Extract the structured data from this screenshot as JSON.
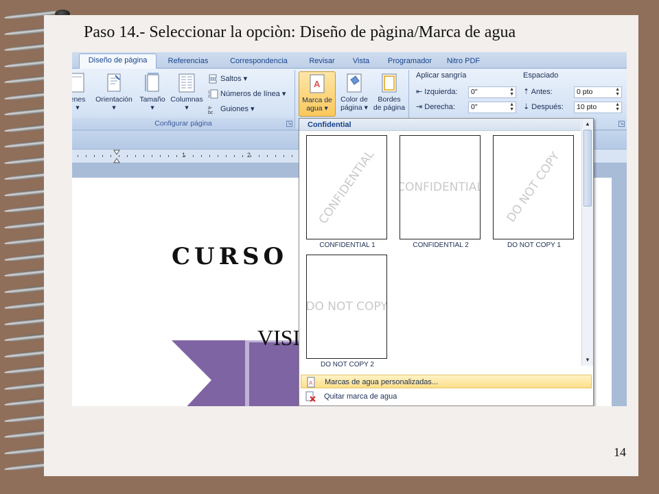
{
  "slide": {
    "title": "Paso 14.- Seleccionar la opciòn: Diseño de pàgina/Marca de agua",
    "page_number": "14"
  },
  "ribbon_tabs": [
    "Diseño de página",
    "Referencias",
    "Correspondencia",
    "Revisar",
    "Vista",
    "Programador",
    "Nitro PDF"
  ],
  "active_tab": "Diseño de página",
  "configurar_pagina": {
    "group_label": "Configurar página",
    "margenes": "enes",
    "orientacion": "Orientación",
    "tamano": "Tamaño",
    "columnas": "Columnas",
    "saltos": "Saltos",
    "numeros_linea": "Números de línea",
    "guiones": "Guiones"
  },
  "fondo_pagina": {
    "marca_de_agua": [
      "Marca de",
      "agua"
    ],
    "color_de_pagina": [
      "Color de",
      "página"
    ],
    "bordes_de_pagina": [
      "Bordes",
      "de página"
    ]
  },
  "parrafo": {
    "aplicar_sangria": "Aplicar sangría",
    "izquierda_label": "Izquierda:",
    "izquierda_value": "0\"",
    "derecha_label": "Derecha:",
    "derecha_value": "0\"",
    "espaciado": "Espaciado",
    "antes_label": "Antes:",
    "antes_value": "0 pto",
    "despues_label": "Después:",
    "despues_value": "10 pto"
  },
  "ruler_numbers": [
    "1",
    "2"
  ],
  "document": {
    "heading_text": "CURSO",
    "shape_text": "VISI"
  },
  "gallery": {
    "section": "Confidential",
    "items": [
      {
        "caption": "CONFIDENTIAL 1",
        "watermark": "CONFIDENTIAL"
      },
      {
        "caption": "CONFIDENTIAL 2",
        "watermark": "CONFIDENTIAL"
      },
      {
        "caption": "DO NOT COPY 1",
        "watermark": "DO NOT COPY"
      },
      {
        "caption": "DO NOT COPY 2",
        "watermark": "DO NOT COPY"
      }
    ],
    "menu": {
      "custom": "Marcas de agua personalizadas...",
      "remove": "Quitar marca de agua"
    }
  },
  "colors": {
    "background": "#8f6f5a",
    "slide": "#f2efec",
    "ribbon_text": "#15428b",
    "highlight": "#fddf8a",
    "shape_purple": "#7f64a3"
  }
}
